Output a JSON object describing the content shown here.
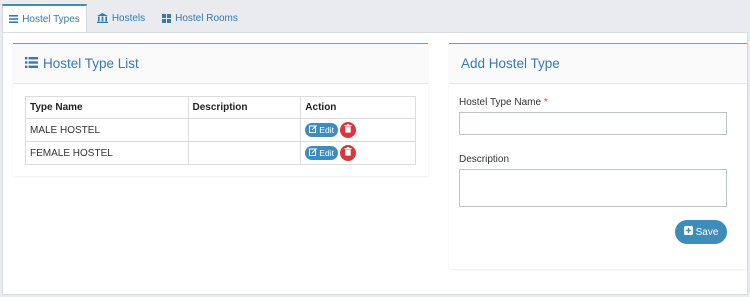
{
  "tabs": [
    {
      "label": "Hostel Types",
      "icon": "list-icon",
      "active": true
    },
    {
      "label": "Hostels",
      "icon": "building-icon",
      "active": false
    },
    {
      "label": "Hostel Rooms",
      "icon": "grid-icon",
      "active": false
    }
  ],
  "list": {
    "title": "Hostel Type List",
    "columns": [
      "Type Name",
      "Description",
      "Action"
    ],
    "rows": [
      {
        "name": "MALE HOSTEL",
        "description": ""
      },
      {
        "name": "FEMALE HOSTEL",
        "description": ""
      }
    ],
    "edit_label": "Edit"
  },
  "form": {
    "title": "Add Hostel Type",
    "name_label": "Hostel Type Name",
    "required_mark": "*",
    "name_value": "",
    "description_label": "Description",
    "description_value": "",
    "save_label": "Save"
  },
  "colors": {
    "accent": "#3c8dbc",
    "title": "#3c76b5",
    "danger": "#d9363e"
  }
}
